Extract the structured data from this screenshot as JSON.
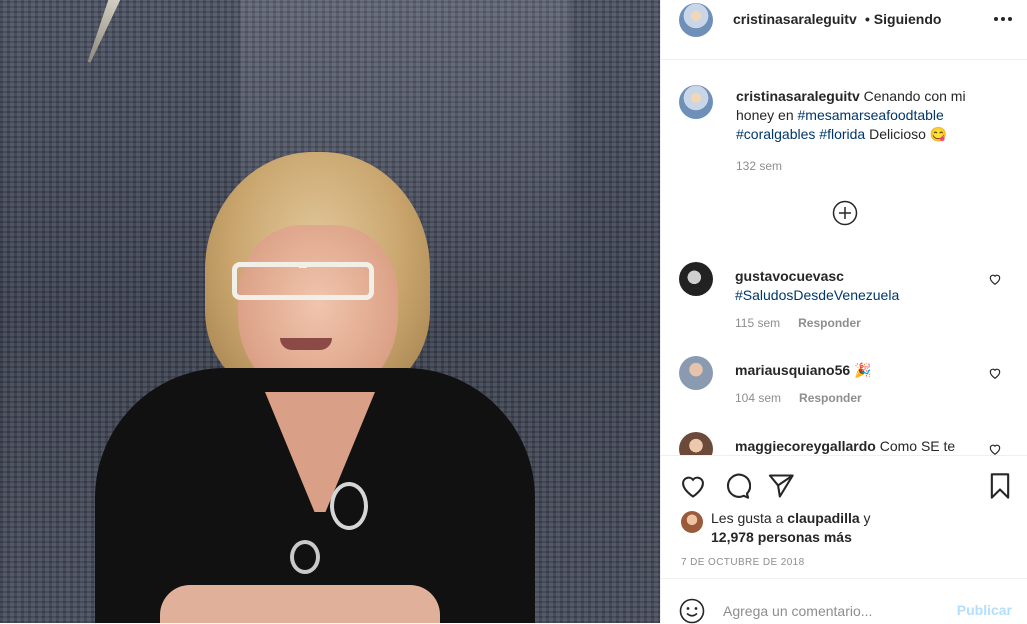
{
  "post": {
    "author": "cristinasaraleguitv",
    "follow_status": "• Siguiendo",
    "caption": {
      "username": "cristinasaraleguitv",
      "text_before": " Cenando con mi honey en ",
      "tag1": "#mesamarseafoodtable",
      "tag2": "#coralgables",
      "tag3": "#florida",
      "text_after": " Delicioso 😋",
      "time": "132 sem"
    },
    "comments": [
      {
        "username": "gustavocuevasc",
        "text": "",
        "tag": "#SaludosDesdeVenezuela",
        "time": "115 sem",
        "reply_label": "Responder"
      },
      {
        "username": "mariausquiano56",
        "text": " 🎉",
        "tag": "",
        "time": "104 sem",
        "reply_label": "Responder"
      },
      {
        "username": "maggiecoreygallardo",
        "text": " Como SE te",
        "tag": "",
        "time": "",
        "reply_label": ""
      }
    ],
    "likes": {
      "prefix": "Les gusta a ",
      "user": "claupadilla",
      "connector": " y",
      "count": "12,978 personas más"
    },
    "date": "7 de octubre de 2018",
    "composer": {
      "placeholder": "Agrega un comentario...",
      "publish_label": "Publicar"
    }
  },
  "icons": {
    "more": "more-horizontal-icon",
    "load_more": "plus-circle-icon",
    "like": "heart-icon",
    "comment": "comment-bubble-icon",
    "share": "paper-plane-icon",
    "save": "bookmark-icon",
    "emoji": "smiley-icon"
  }
}
